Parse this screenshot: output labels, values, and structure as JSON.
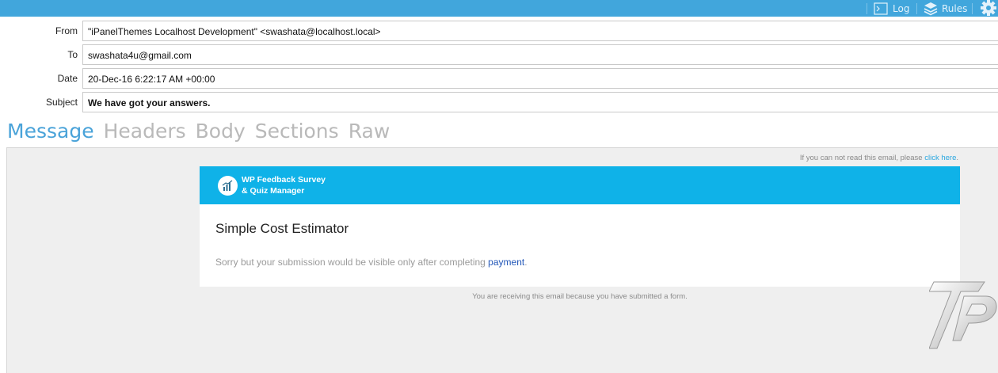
{
  "toolbar": {
    "log_label": "Log",
    "rules_label": "Rules",
    "log_icon": "terminal-icon",
    "rules_icon": "layers-icon",
    "settings_icon": "gear-icon",
    "bar_color": "#41a6dc"
  },
  "headers": {
    "from_label": "From",
    "from_value": "\"iPanelThemes Localhost Development\" <swashata@localhost.local>",
    "to_label": "To",
    "to_value": "swashata4u@gmail.com",
    "date_label": "Date",
    "date_value": "20-Dec-16 6:22:17 AM +00:00",
    "subject_label": "Subject",
    "subject_value": "We have got your answers."
  },
  "tabs": [
    {
      "label": "Message",
      "active": true
    },
    {
      "label": "Headers",
      "active": false
    },
    {
      "label": "Body",
      "active": false
    },
    {
      "label": "Sections",
      "active": false
    },
    {
      "label": "Raw",
      "active": false
    }
  ],
  "email": {
    "notice_text": "If you can not read this email, please ",
    "notice_link": "click here",
    "notice_end": ".",
    "brand_line1": "WP Feedback Survey",
    "brand_line2": "& Quiz Manager",
    "brand_icon": "chart-logo-icon",
    "brand_color": "#0fb2e8",
    "title": "Simple Cost Estimator",
    "message_text": "Sorry but your submission would be visible only after completing ",
    "message_link": "payment",
    "message_end": ".",
    "footer": "You are receiving this email because you have submitted a form."
  }
}
